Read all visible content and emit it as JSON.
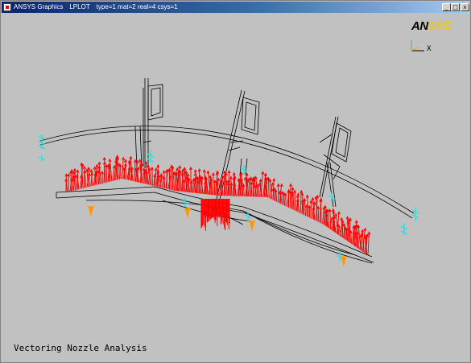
{
  "window": {
    "app_title": "ANSYS Graphics",
    "command": "LPLOT",
    "attributes": "type=1 mat=2 real=4 csys=1"
  },
  "logo": {
    "part1": "AN",
    "part2": "SYS"
  },
  "triad": {
    "x_label": "X"
  },
  "caption": "Vectoring Nozzle Analysis",
  "colors": {
    "background": "#c1c1c1",
    "force_vectors": "#ff0000",
    "constraints": "#33dddd",
    "supports": "#ff9900",
    "wireframe": "#000000"
  }
}
